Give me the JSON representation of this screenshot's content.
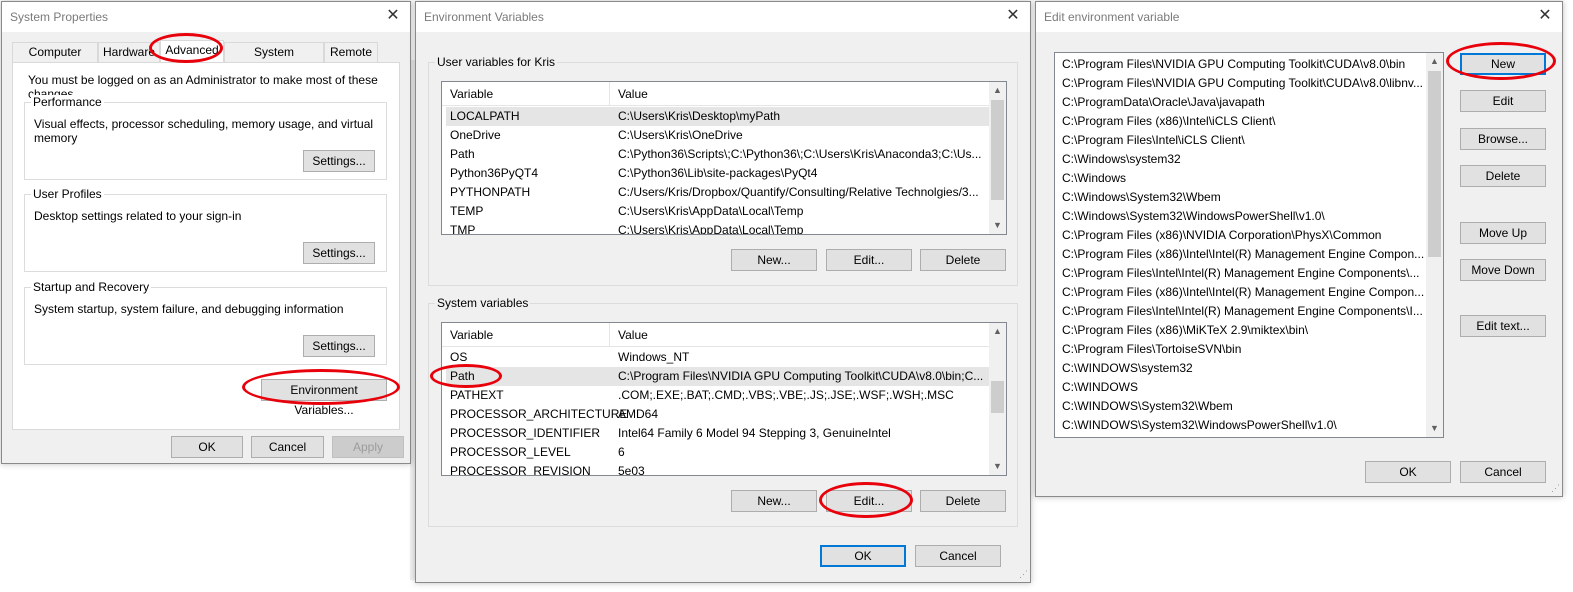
{
  "system_properties": {
    "title": "System Properties",
    "tabs": [
      "Computer Name",
      "Hardware",
      "Advanced",
      "System Protection",
      "Remote"
    ],
    "active_tab": "Advanced",
    "admin_note": "You must be logged on as an Administrator to make most of these changes.",
    "performance": {
      "label": "Performance",
      "desc": "Visual effects, processor scheduling, memory usage, and virtual memory",
      "button": "Settings..."
    },
    "user_profiles": {
      "label": "User Profiles",
      "desc": "Desktop settings related to your sign-in",
      "button": "Settings..."
    },
    "startup": {
      "label": "Startup and Recovery",
      "desc": "System startup, system failure, and debugging information",
      "button": "Settings..."
    },
    "env_button": "Environment Variables...",
    "ok": "OK",
    "cancel": "Cancel",
    "apply": "Apply"
  },
  "env_vars": {
    "title": "Environment Variables",
    "user_group": "User variables for Kris",
    "system_group": "System variables",
    "col_variable": "Variable",
    "col_value": "Value",
    "user_rows": [
      [
        "LOCALPATH",
        "C:\\Users\\Kris\\Desktop\\myPath"
      ],
      [
        "OneDrive",
        "C:\\Users\\Kris\\OneDrive"
      ],
      [
        "Path",
        "C:\\Python36\\Scripts\\;C:\\Python36\\;C:\\Users\\Kris\\Anaconda3;C:\\Us..."
      ],
      [
        "Python36PyQT4",
        "C:\\Python36\\Lib\\site-packages\\PyQt4"
      ],
      [
        "PYTHONPATH",
        "C:/Users/Kris/Dropbox/Quantify/Consulting/Relative Technolgies/3..."
      ],
      [
        "TEMP",
        "C:\\Users\\Kris\\AppData\\Local\\Temp"
      ],
      [
        "TMP",
        "C:\\Users\\Kris\\AppData\\Local\\Temp"
      ]
    ],
    "system_rows": [
      [
        "OS",
        "Windows_NT"
      ],
      [
        "Path",
        "C:\\Program Files\\NVIDIA GPU Computing Toolkit\\CUDA\\v8.0\\bin;C..."
      ],
      [
        "PATHEXT",
        ".COM;.EXE;.BAT;.CMD;.VBS;.VBE;.JS;.JSE;.WSF;.WSH;.MSC"
      ],
      [
        "PROCESSOR_ARCHITECTURE",
        "AMD64"
      ],
      [
        "PROCESSOR_IDENTIFIER",
        "Intel64 Family 6 Model 94 Stepping 3, GenuineIntel"
      ],
      [
        "PROCESSOR_LEVEL",
        "6"
      ],
      [
        "PROCESSOR_REVISION",
        "5e03"
      ]
    ],
    "new": "New...",
    "edit": "Edit...",
    "delete": "Delete",
    "ok": "OK",
    "cancel": "Cancel"
  },
  "edit_env": {
    "title": "Edit environment variable",
    "paths": [
      "C:\\Program Files\\NVIDIA GPU Computing Toolkit\\CUDA\\v8.0\\bin",
      "C:\\Program Files\\NVIDIA GPU Computing Toolkit\\CUDA\\v8.0\\libnv...",
      "C:\\ProgramData\\Oracle\\Java\\javapath",
      "C:\\Program Files (x86)\\Intel\\iCLS Client\\",
      "C:\\Program Files\\Intel\\iCLS Client\\",
      "C:\\Windows\\system32",
      "C:\\Windows",
      "C:\\Windows\\System32\\Wbem",
      "C:\\Windows\\System32\\WindowsPowerShell\\v1.0\\",
      "C:\\Program Files (x86)\\NVIDIA Corporation\\PhysX\\Common",
      "C:\\Program Files (x86)\\Intel\\Intel(R) Management Engine Compon...",
      "C:\\Program Files\\Intel\\Intel(R) Management Engine Components\\...",
      "C:\\Program Files (x86)\\Intel\\Intel(R) Management Engine Compon...",
      "C:\\Program Files\\Intel\\Intel(R) Management Engine Components\\I...",
      "C:\\Program Files (x86)\\MiKTeX 2.9\\miktex\\bin\\",
      "C:\\Program Files\\TortoiseSVN\\bin",
      "C:\\WINDOWS\\system32",
      "C:\\WINDOWS",
      "C:\\WINDOWS\\System32\\Wbem",
      "C:\\WINDOWS\\System32\\WindowsPowerShell\\v1.0\\"
    ],
    "buttons": {
      "new": "New",
      "edit": "Edit",
      "browse": "Browse...",
      "delete": "Delete",
      "move_up": "Move Up",
      "move_down": "Move Down",
      "edit_text": "Edit text..."
    },
    "ok": "OK",
    "cancel": "Cancel"
  },
  "colors": {
    "annotation": "#e8000b",
    "focus": "#0078d7",
    "window_bg": "#f0f0f0"
  }
}
